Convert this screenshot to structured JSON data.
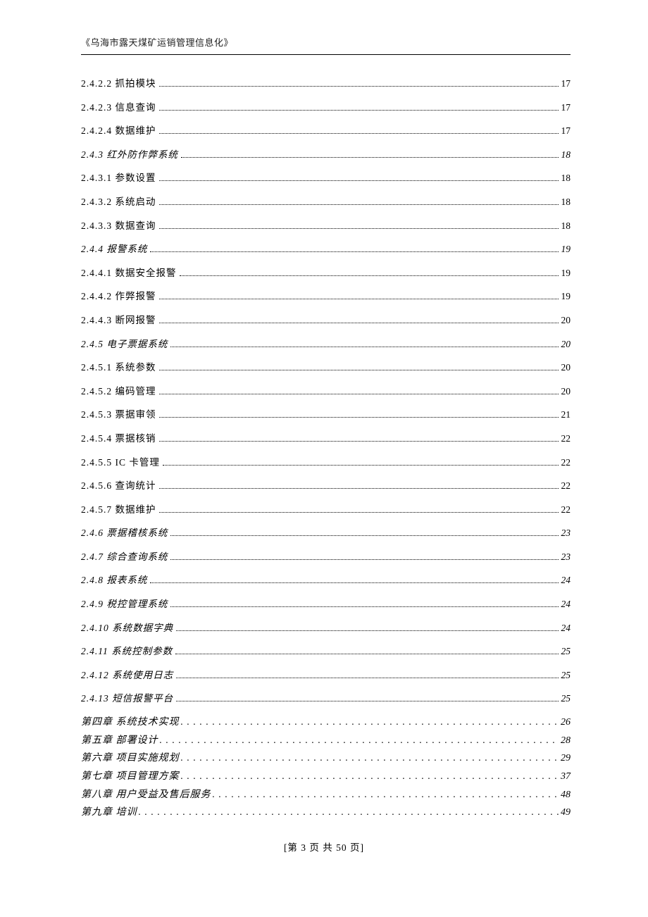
{
  "header": "《乌海市露天煤矿运销管理信息化》",
  "toc": [
    {
      "label": "2.4.2.2 抓拍模块",
      "page": "17",
      "italic": false
    },
    {
      "label": "2.4.2.3 信息查询",
      "page": "17",
      "italic": false
    },
    {
      "label": "2.4.2.4 数据维护",
      "page": "17",
      "italic": false
    },
    {
      "label": "2.4.3 红外防作弊系统",
      "page": "18",
      "italic": true
    },
    {
      "label": "2.4.3.1 参数设置",
      "page": "18",
      "italic": false
    },
    {
      "label": "2.4.3.2 系统启动",
      "page": "18",
      "italic": false
    },
    {
      "label": "2.4.3.3 数据查询",
      "page": "18",
      "italic": false
    },
    {
      "label": "2.4.4 报警系统",
      "page": "19",
      "italic": true
    },
    {
      "label": "2.4.4.1 数据安全报警",
      "page": "19",
      "italic": false
    },
    {
      "label": "2.4.4.2 作弊报警",
      "page": "19",
      "italic": false
    },
    {
      "label": "2.4.4.3 断网报警",
      "page": "20",
      "italic": false
    },
    {
      "label": "2.4.5 电子票据系统",
      "page": "20",
      "italic": true
    },
    {
      "label": "2.4.5.1 系统参数",
      "page": "20",
      "italic": false
    },
    {
      "label": "2.4.5.2 编码管理",
      "page": "20",
      "italic": false
    },
    {
      "label": "2.4.5.3 票据审领",
      "page": "21",
      "italic": false
    },
    {
      "label": "2.4.5.4 票据核销",
      "page": "22",
      "italic": false
    },
    {
      "label": "2.4.5.5 IC 卡管理",
      "page": "22",
      "italic": false
    },
    {
      "label": "2.4.5.6 查询统计",
      "page": "22",
      "italic": false
    },
    {
      "label": "2.4.5.7 数据维护",
      "page": "22",
      "italic": false
    },
    {
      "label": "2.4.6 票据稽核系统",
      "page": "23",
      "italic": true
    },
    {
      "label": "2.4.7 综合查询系统",
      "page": "23",
      "italic": true
    },
    {
      "label": "2.4.8 报表系统",
      "page": "24",
      "italic": true
    },
    {
      "label": "2.4.9 税控管理系统",
      "page": "24",
      "italic": true
    },
    {
      "label": "2.4.10 系统数据字典",
      "page": "24",
      "italic": true
    },
    {
      "label": "2.4.11 系统控制参数",
      "page": "25",
      "italic": true
    },
    {
      "label": "2.4.12 系统使用日志",
      "page": "25",
      "italic": true
    },
    {
      "label": "2.4.13 短信报警平台",
      "page": "25",
      "italic": true
    }
  ],
  "chapters": [
    {
      "label": "第四章 系统技术实现",
      "page": "26"
    },
    {
      "label": "第五章 部署设计",
      "page": "28"
    },
    {
      "label": "第六章 项目实施规划",
      "page": "29"
    },
    {
      "label": "第七章 项目管理方案",
      "page": "37"
    },
    {
      "label": "第八章 用户受益及售后服务",
      "page": "48"
    },
    {
      "label": "第九章 培训",
      "page": "49"
    }
  ],
  "footer": "[第 3 页  共 50 页]"
}
